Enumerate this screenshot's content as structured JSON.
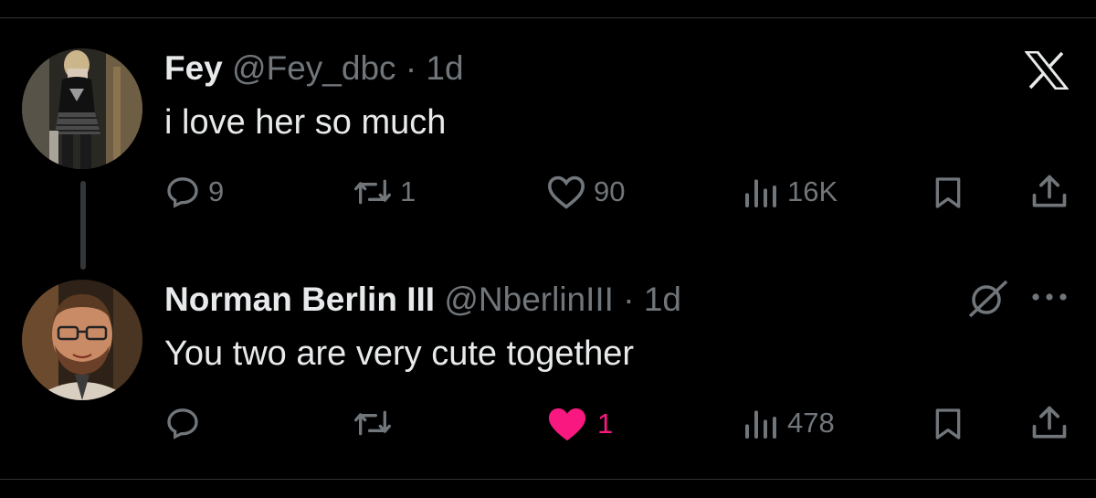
{
  "colors": {
    "background": "#000000",
    "primary_text": "#e7e9ea",
    "secondary_text": "#71767b",
    "like_active": "#f91880"
  },
  "app": {
    "logo": "x-logo-icon"
  },
  "tweets": [
    {
      "name": "Fey",
      "handle": "@Fey_dbc",
      "separator": "·",
      "time": "1d",
      "text": "i love her so much",
      "replies": "9",
      "reposts": "1",
      "likes": "90",
      "views": "16K",
      "liked": false
    },
    {
      "name": "Norman Berlin III",
      "handle": "@NberlinIII",
      "separator": "·",
      "time": "1d",
      "text": "You two are very cute together",
      "replies": "",
      "reposts": "",
      "likes": "1",
      "views": "478",
      "liked": true,
      "menu_icons": [
        "grok-icon",
        "more-icon"
      ]
    }
  ]
}
